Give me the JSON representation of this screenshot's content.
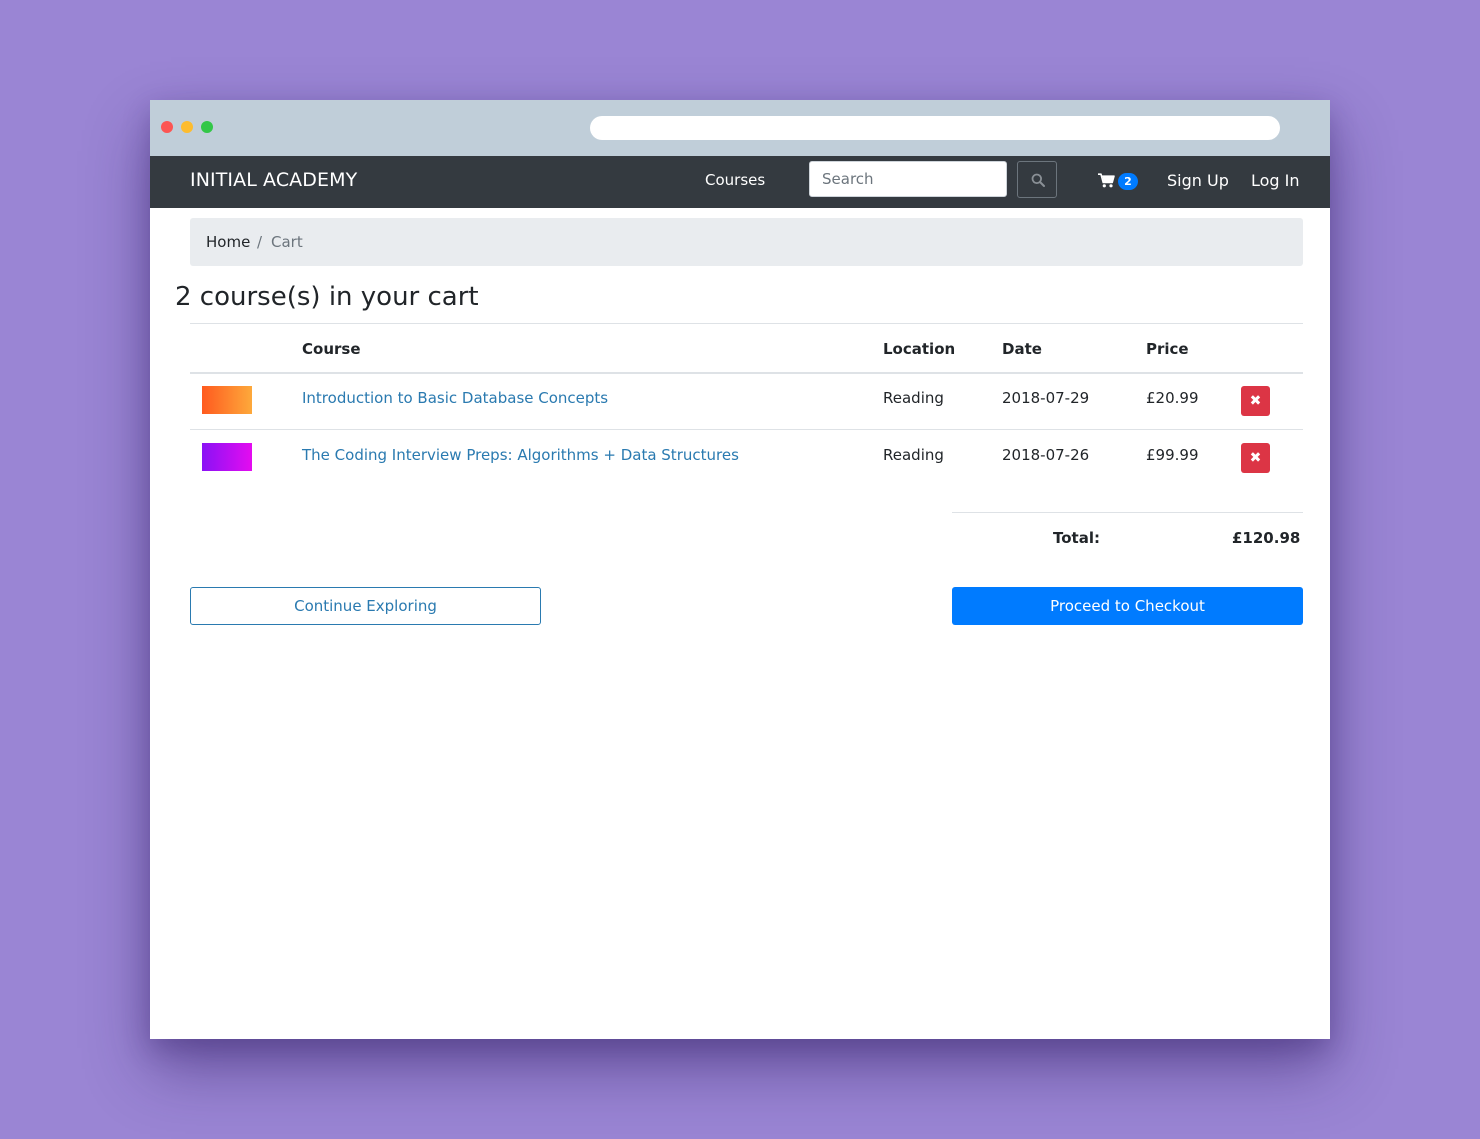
{
  "navbar": {
    "brand": "INITIAL ACADEMY",
    "courses_label": "Courses",
    "search_placeholder": "Search",
    "cart_count": "2",
    "signup_label": "Sign Up",
    "login_label": "Log In"
  },
  "breadcrumb": {
    "home": "Home",
    "separator": "/",
    "current": "Cart"
  },
  "page_title": "2 course(s) in your cart",
  "cart_table": {
    "headers": {
      "course": "Course",
      "location": "Location",
      "date": "Date",
      "price": "Price"
    },
    "rows": [
      {
        "thumbnail_colors": [
          "#ff5a1f",
          "#fda93b"
        ],
        "course": "Introduction to Basic Database Concepts",
        "location": "Reading",
        "date": "2018-07-29",
        "price": "£20.99",
        "remove_icon": "close-icon"
      },
      {
        "thumbnail_colors": [
          "#8a12f5",
          "#e40cf0"
        ],
        "course": "The Coding Interview Preps: Algorithms + Data Structures",
        "location": "Reading",
        "date": "2018-07-26",
        "price": "£99.99",
        "remove_icon": "close-icon"
      }
    ]
  },
  "totals": {
    "label": "Total:",
    "value": "£120.98"
  },
  "actions": {
    "continue_label": "Continue Exploring",
    "checkout_label": "Proceed to Checkout"
  },
  "colors": {
    "background": "#9a85d4",
    "navbar": "#343a40",
    "primary": "#007bff",
    "danger": "#dc3545",
    "link": "#2a7ab0"
  }
}
